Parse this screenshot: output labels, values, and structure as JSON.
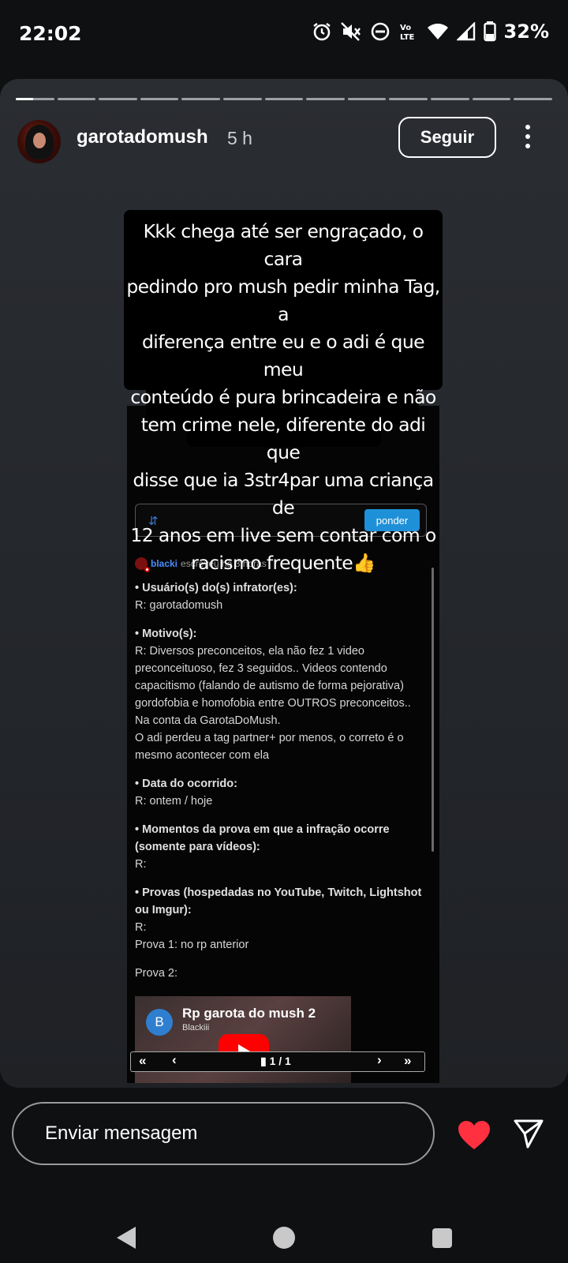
{
  "status_bar": {
    "time": "22:02",
    "icons": [
      "alarm-icon",
      "mute-icon",
      "dnd-icon",
      "volte-icon",
      "wifi-icon",
      "signal-icon",
      "battery-icon"
    ],
    "volte_label": "Vo\nLTE",
    "battery_percent": "32%"
  },
  "story": {
    "segments_total": 13,
    "current_segment": 1,
    "current_progress": 0.45,
    "username": "garotadomush",
    "time_ago": "5 h",
    "follow_label": "Seguir",
    "caption": "Kkk chega até ser engraçado, o  cara\npedindo pro mush pedir minha Tag, a\ndiferença entre eu e o adi é que meu\nconteúdo é pura brincadeira e não\ntem crime nele, diferente do adi que\ndisse que ia 3str4par uma criança de\n12 anos em live sem contar com o\nracismo frequente👍"
  },
  "embedded_post": {
    "reply_label": "ponder",
    "author": "blacki",
    "author_meta": "escreveu há 3 horas",
    "paragraphs": [
      {
        "q": "• Usuário(s) do(s) infrator(es):",
        "a": "R: garotadomush"
      },
      {
        "q": "• Motivo(s):",
        "a": "R: Diversos preconceitos, ela não fez 1 video preconceituoso, fez 3 seguidos.. Videos contendo capacitismo (falando de autismo de forma pejorativa) gordofobia e homofobia entre OUTROS preconceitos.. Na conta da GarotaDoMush.\nO adi perdeu a tag partner+ por menos, o correto é o mesmo acontecer com ela"
      },
      {
        "q": "• Data do ocorrido:",
        "a": "R: ontem / hoje"
      },
      {
        "q": "• Momentos da prova em que a infração ocorre (somente para vídeos):",
        "a": "R:"
      },
      {
        "q": "• Provas (hospedadas no YouTube, Twitch, Lightshot ou Imgur):",
        "a": "R:\nProva 1: no rp anterior"
      },
      {
        "q": "",
        "a": "Prova 2:"
      }
    ],
    "video": {
      "avatar_letter": "B",
      "title": "Rp garota do mush 2",
      "channel": "Blackiii"
    },
    "pager": {
      "first": "«",
      "prev": "‹",
      "label": "1 / 1",
      "next": "›",
      "last": "»"
    }
  },
  "bottom_bar": {
    "message_placeholder": "Enviar mensagem",
    "like_color": "#ff3040"
  },
  "nav": {
    "icons": [
      "back-icon",
      "home-icon",
      "recents-icon"
    ]
  }
}
